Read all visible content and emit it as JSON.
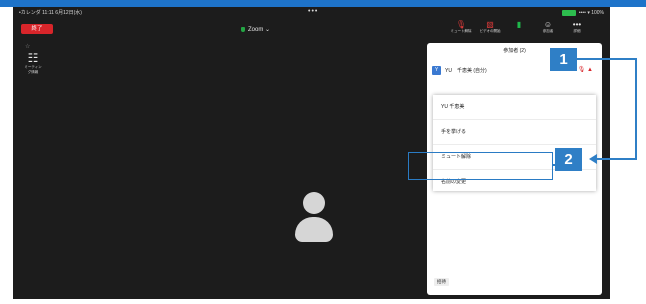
{
  "statusbar": {
    "left_text": "•カレンダ  11:11  6月12日(水)",
    "dots": "•••",
    "signal_text": "•••• ▾ 100%"
  },
  "meeting": {
    "end_label": "終了",
    "title": "Zoom ⌄"
  },
  "toolbar": {
    "items": [
      {
        "glyph": "🎙",
        "label": "ミュート解除"
      },
      {
        "glyph": "▧",
        "label": "ビデオの開始"
      },
      {
        "glyph": "▮",
        "label": ""
      },
      {
        "glyph": "☺",
        "label": "参加者"
      },
      {
        "glyph": "•••",
        "label": "詳細"
      }
    ]
  },
  "side": {
    "star": "☆",
    "glyph": "☷",
    "label": "ミーティング情報"
  },
  "panel": {
    "title": "参加者 (2)",
    "participant_initial": "Y",
    "participant_name": "YU　千恵美 (自分)",
    "participant_icons": "🎙 ▲",
    "menu": [
      "YU 千恵美",
      "手を挙げる",
      "ミュート解除",
      "名前の変更"
    ],
    "footer": "招待"
  },
  "callouts": {
    "one": "1",
    "two": "2"
  },
  "colors": {
    "accent": "#2f7fc6",
    "end": "#d8252a",
    "background": "#1c1c1c"
  }
}
